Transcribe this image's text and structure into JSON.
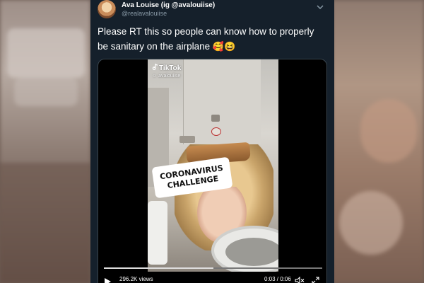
{
  "tweet": {
    "display_name": "Ava Louise (ig @avalouiise)",
    "handle": "@realavalouiise",
    "text": "Please RT this so people can know how to properly be sanitary on the airplane",
    "emojis": "🥰😆",
    "menu_icon": "chevron-down-icon"
  },
  "video": {
    "watermark_brand": "TikTok",
    "watermark_user": "avalouiise",
    "sticker_line1": "CORONAVIRUS",
    "sticker_line2": "CHALLENGE",
    "views": "296.2K views",
    "time": "0:03 / 0:06",
    "progress": 0.5,
    "play_icon": "play-icon",
    "mute_icon": "speaker-muted-icon",
    "fullscreen_icon": "expand-icon"
  },
  "colors": {
    "card_background": "#15202b",
    "secondary_text": "#8899a6",
    "border": "#38444d"
  }
}
